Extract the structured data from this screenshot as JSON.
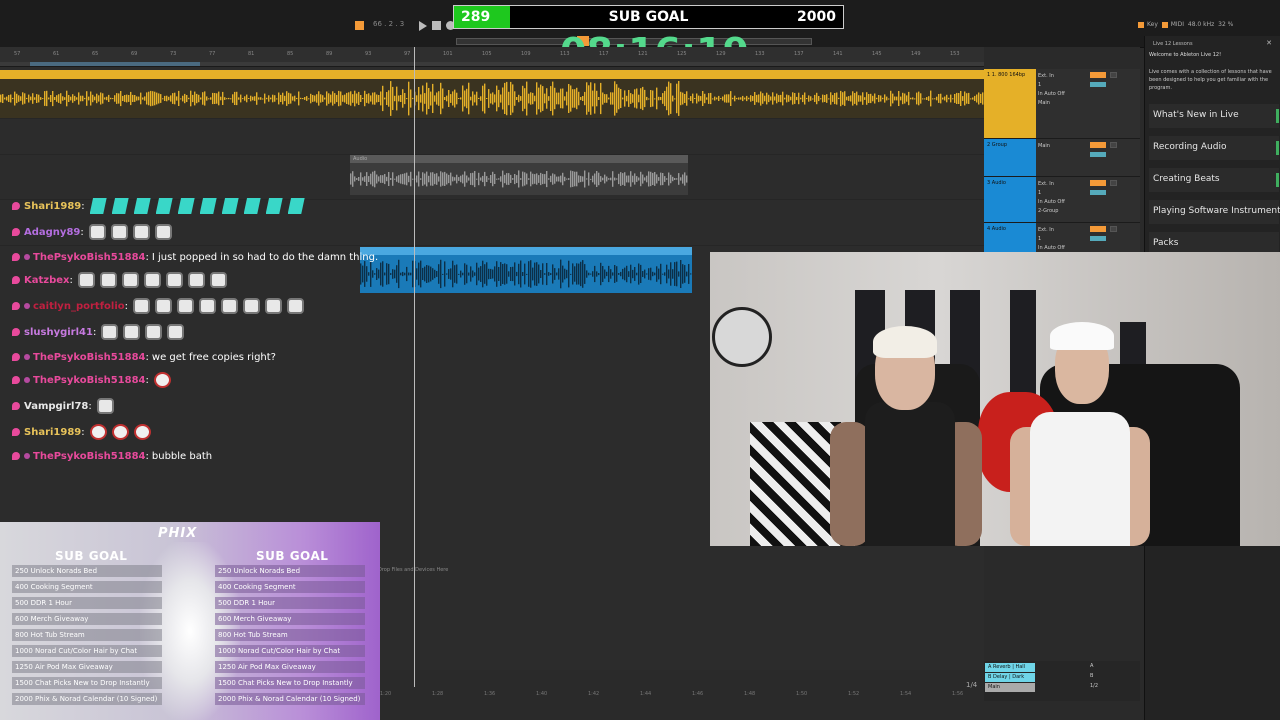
{
  "transport": {
    "tempo": "66 . 2 . 3"
  },
  "sub_goal_bar": {
    "current": "289",
    "title": "SUB GOAL",
    "target": "2000",
    "progress": 0.1445,
    "fill_color": "#1ec81e"
  },
  "timer": "08:16:19",
  "status": {
    "key": "Key",
    "midi": "MIDI",
    "samplerate": "48.0 kHz",
    "cpu": "32 %"
  },
  "ruler_ticks": [
    "57",
    "61",
    "65",
    "69",
    "73",
    "77",
    "81",
    "85",
    "89",
    "93",
    "97",
    "101",
    "105",
    "109",
    "113",
    "117",
    "121",
    "125",
    "129",
    "133",
    "137",
    "141",
    "145",
    "149",
    "153"
  ],
  "bottom_ruler_ticks": [
    "1:20",
    "1:28",
    "1:36",
    "1:40",
    "1:42",
    "1:44",
    "1:46",
    "1:48",
    "1:50",
    "1:52",
    "1:54",
    "1:56"
  ],
  "arrangement": {
    "gray_clip_label": "Audio",
    "drop_hint": "Drop Files and Devices Here",
    "pager": "1/4"
  },
  "tracks": [
    {
      "name": "1 1. 800 164bp",
      "color": "#e5b028",
      "io": [
        "Ext. In",
        "1",
        "In  Auto  Off",
        "Main"
      ],
      "vol": "0"
    },
    {
      "name": "2 Group",
      "color": "#1a8ad4",
      "io": [
        "Main"
      ],
      "vol": "0"
    },
    {
      "name": "3 Audio",
      "color": "#1a8ad4",
      "io": [
        "Ext. In",
        "1",
        "In  Auto  Off",
        "2-Group"
      ],
      "vol": "0"
    },
    {
      "name": "4 Audio",
      "color": "#1a8ad4",
      "io": [
        "Ext. In",
        "1",
        "In  Auto  Off",
        "2-Group"
      ],
      "vol": "0"
    }
  ],
  "returns": [
    {
      "name": "A Reverb | Hall",
      "ctl": "A"
    },
    {
      "name": "B Delay | Dark",
      "ctl": "B"
    },
    {
      "name": "Main",
      "ctl": "1/2"
    }
  ],
  "help_panel": {
    "header": "Live 12 Lessons",
    "intro_title": "Welcome to Ableton Live 12!",
    "intro": "Live comes with a collection of lessons that have been designed to help you get familiar with the program.",
    "lessons": [
      "What's New in Live",
      "Recording Audio",
      "Creating Beats",
      "Playing Software Instruments",
      "Packs"
    ]
  },
  "chat": [
    {
      "name": "Shari1989",
      "color": "#e8c35a",
      "text": "",
      "emote": "crys",
      "count": 10
    },
    {
      "name": "Adagny89",
      "color": "#b46ee0",
      "text": "",
      "emote": "cat",
      "count": 4
    },
    {
      "name": "ThePsykoBish51884",
      "color": "#e84a9c",
      "text": "I just popped in so had to do the damn thing.",
      "emote": "",
      "count": 0
    },
    {
      "name": "Katzbex",
      "color": "#e84a9c",
      "text": "",
      "emote": "cat",
      "count": 7
    },
    {
      "name": "caitlyn_portfolio",
      "color": "#c02040",
      "text": "",
      "emote": "cat",
      "count": 8
    },
    {
      "name": "slushygirl41",
      "color": "#c77ae0",
      "text": "",
      "emote": "cat",
      "count": 4
    },
    {
      "name": "ThePsykoBish51884",
      "color": "#e84a9c",
      "text": "we get free copies right?",
      "emote": "",
      "count": 0
    },
    {
      "name": "ThePsykoBish51884",
      "color": "#e84a9c",
      "text": "",
      "emote": "dog",
      "count": 1
    },
    {
      "name": "Vampgirl78",
      "color": "#e8e8e8",
      "text": "",
      "emote": "cat",
      "count": 1
    },
    {
      "name": "Shari1989",
      "color": "#e8c35a",
      "text": "",
      "emote": "dog",
      "count": 3
    },
    {
      "name": "ThePsykoBish51884",
      "color": "#e84a9c",
      "text": "bubble bath",
      "emote": "",
      "count": 0
    }
  ],
  "goal_panel": {
    "logo": "PHIX",
    "left_title": "SUB GOAL",
    "right_title": "SUB GOAL",
    "items": [
      "250 Unlock Norads Bed",
      "400 Cooking Segment",
      "500 DDR 1 Hour",
      "600 Merch Giveaway",
      "800 Hot Tub Stream",
      "1000 Norad Cut/Color Hair by Chat",
      "1250 Air Pod Max Giveaway",
      "1500 Chat Picks New to Drop Instantly",
      "2000 Phix & Norad Calendar (10 Signed)"
    ]
  }
}
